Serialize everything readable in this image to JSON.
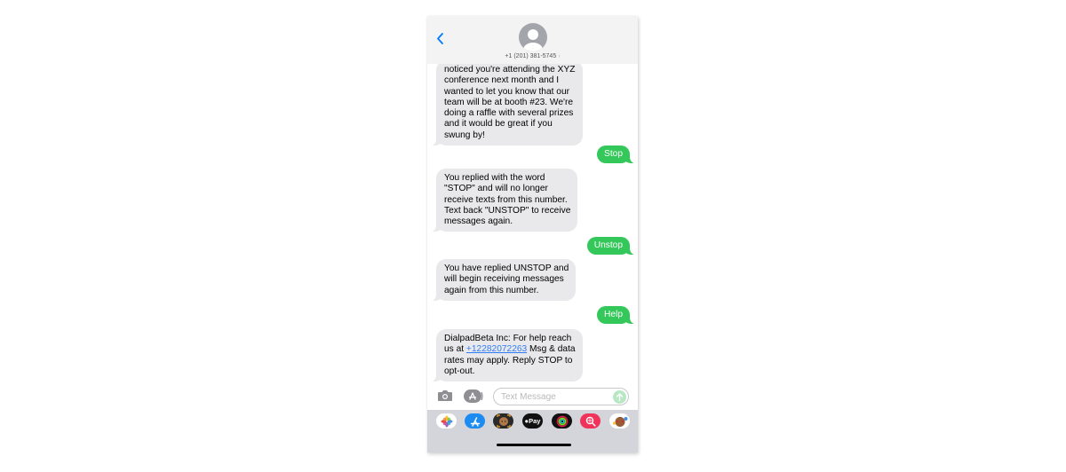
{
  "header": {
    "back_label": "Back",
    "contact_number": "+1 (201) 381-5745",
    "contact_chevron": "›"
  },
  "messages": [
    {
      "direction": "received",
      "text": "noticed you're attending the XYZ\nconference next month and I\nwanted to let you know that our\nteam will be at booth #23. We're\ndoing a raffle with several prizes\nand it would be great if you\nswung by!"
    },
    {
      "direction": "sent",
      "text": "Stop"
    },
    {
      "direction": "received",
      "text": "You replied with the word\n\"STOP\" and will no longer\nreceive texts from this number.\nText back \"UNSTOP\" to receive\nmessages again."
    },
    {
      "direction": "sent",
      "text": "Unstop"
    },
    {
      "direction": "received",
      "text": "You have replied UNSTOP and\nwill begin receiving messages\nagain from this number."
    },
    {
      "direction": "sent",
      "text": "Help"
    },
    {
      "direction": "received",
      "text_before_link": "DialpadBeta Inc: For help reach\nus at ",
      "link": "+12282072263",
      "text_after_link": " Msg & data\nrates may apply. Reply STOP to\nopt-out."
    }
  ],
  "composer": {
    "placeholder": "Text Message",
    "value": ""
  },
  "app_drawer": {
    "apps": [
      {
        "name": "Photos",
        "icon": "photos-icon"
      },
      {
        "name": "App Store",
        "icon": "app-store-icon"
      },
      {
        "name": "Memoji",
        "icon": "memoji-icon"
      },
      {
        "name": "Apple Pay",
        "icon": "apple-pay-icon",
        "label": "Pay"
      },
      {
        "name": "Activity",
        "icon": "activity-icon"
      },
      {
        "name": "Search Images",
        "icon": "image-search-icon"
      },
      {
        "name": "Animoji Stickers",
        "icon": "memoji-stickers-icon"
      }
    ]
  },
  "colors": {
    "sent_bubble": "#34c759",
    "received_bubble": "#e9e9eb",
    "link": "#2f7cf6",
    "ios_blue": "#007aff",
    "header_bg": "#f3f3f3",
    "drawer_bg": "#d3d5db"
  }
}
